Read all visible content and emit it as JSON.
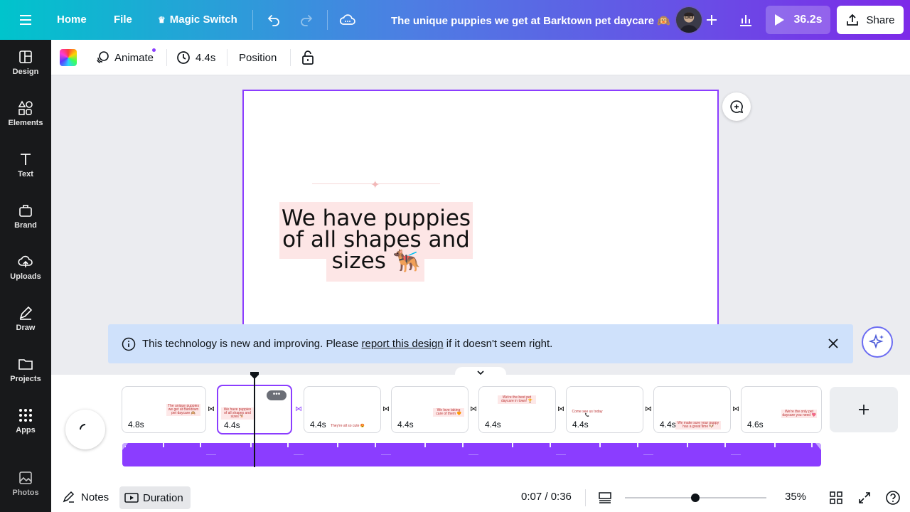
{
  "topbar": {
    "home": "Home",
    "file": "File",
    "magic_switch": "Magic Switch",
    "title": "The unique puppies we get at Barktown pet daycare 🙉",
    "play_time": "36.2s",
    "share": "Share"
  },
  "sidebar": {
    "items": [
      {
        "label": "Design",
        "icon": "layout-icon"
      },
      {
        "label": "Elements",
        "icon": "shapes-icon"
      },
      {
        "label": "Text",
        "icon": "text-icon"
      },
      {
        "label": "Brand",
        "icon": "brand-icon"
      },
      {
        "label": "Uploads",
        "icon": "cloud-upload-icon"
      },
      {
        "label": "Draw",
        "icon": "pen-icon"
      },
      {
        "label": "Projects",
        "icon": "folder-icon"
      },
      {
        "label": "Apps",
        "icon": "grid-icon"
      },
      {
        "label": "Photos",
        "icon": "image-icon"
      }
    ]
  },
  "context_toolbar": {
    "animate": "Animate",
    "duration": "4.4s",
    "position": "Position"
  },
  "canvas": {
    "line1": "We have puppies",
    "line2": "of all shapes and",
    "line3": "sizes 🐕‍🦺"
  },
  "banner": {
    "text_before": "This technology is new and improving. Please ",
    "link": "report this design",
    "text_after": " if it doesn't seem right."
  },
  "timeline": {
    "pages": [
      {
        "duration": "4.8s",
        "caption": "The unique puppies we get at Barktown pet daycare 🙉"
      },
      {
        "duration": "4.4s",
        "caption": "We have puppies of all shapes and sizes 🐕"
      },
      {
        "duration": "4.4s",
        "caption": "They're all so cute 😍"
      },
      {
        "duration": "4.4s",
        "caption": "We love taking care of them 🧡"
      },
      {
        "duration": "4.4s",
        "caption": "We're the best pet daycare in town! 🏆"
      },
      {
        "duration": "4.4s",
        "caption": "Come see us today 📞"
      },
      {
        "duration": "4.4s",
        "caption": "We make sure your puppy has a great time 🐶"
      },
      {
        "duration": "4.6s",
        "caption": "We're the only pet daycare you need 💖"
      }
    ]
  },
  "footer": {
    "notes": "Notes",
    "duration": "Duration",
    "time": "0:07 / 0:36",
    "zoom": "35%",
    "zoom_level": 0.35
  },
  "colors": {
    "accent": "#8b3dff",
    "teal": "#00c4cc",
    "banner_bg": "#cfe1fb"
  }
}
